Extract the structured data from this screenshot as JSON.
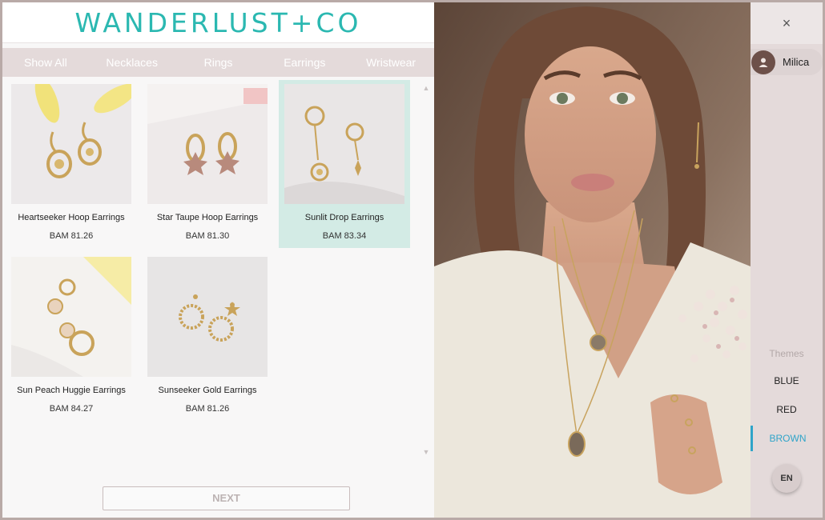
{
  "brand": {
    "logo_text": "WANDERLUST+CO"
  },
  "nav": {
    "items": [
      {
        "label": "Show All"
      },
      {
        "label": "Necklaces"
      },
      {
        "label": "Rings"
      },
      {
        "label": "Earrings"
      },
      {
        "label": "Wristwear"
      }
    ]
  },
  "products": [
    {
      "name": "Heartseeker Hoop Earrings",
      "price": "BAM 81.26",
      "selected": false
    },
    {
      "name": "Star Taupe Hoop Earrings",
      "price": "BAM 81.30",
      "selected": false
    },
    {
      "name": "Sunlit Drop Earrings",
      "price": "BAM 83.34",
      "selected": true
    },
    {
      "name": "Sun Peach Huggie Earrings",
      "price": "BAM 84.27",
      "selected": false
    },
    {
      "name": "Sunseeker Gold Earrings",
      "price": "BAM 81.26",
      "selected": false
    }
  ],
  "pager": {
    "next_label": "NEXT"
  },
  "side": {
    "close_icon": "×",
    "user_name": "Milica",
    "themes_label": "Themes",
    "themes": [
      {
        "label": "BLUE",
        "active": false
      },
      {
        "label": "RED",
        "active": false
      },
      {
        "label": "BROWN",
        "active": true
      }
    ],
    "language": "EN"
  },
  "colors": {
    "accent": "#2bb8b1",
    "active_theme": "#2fa4c9",
    "selected_card": "#d3ebe5",
    "nav_bg": "#e4dada"
  }
}
